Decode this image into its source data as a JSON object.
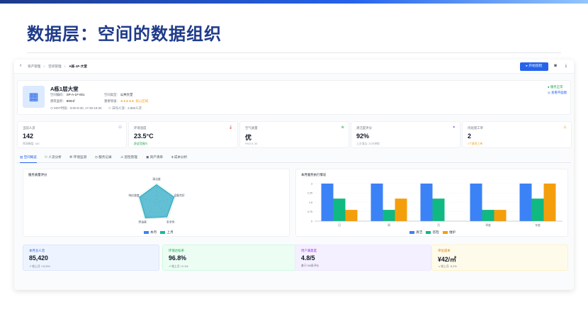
{
  "slide": {
    "title": "数据层：空间的数据组织"
  },
  "header": {
    "breadcrumb": [
      "资产管理",
      "空间管理",
      "A栋-1F-大堂"
    ],
    "start_button": "开始巡检"
  },
  "space": {
    "name": "A栋1层大堂",
    "code_label": "空间编码:",
    "code": "SP-A-1F-001",
    "type_label": "空间类型:",
    "type": "公共大堂",
    "area_label": "建筑面积:",
    "area": "800㎡",
    "importance_label": "重要等级:",
    "importance_stars": "★★★★★",
    "importance_text": "核心区域",
    "hours": "MOT时段：8:00-9:30, 17:30-19:30",
    "flow": "日均人流：2,850人次",
    "status": "● 服务正常",
    "status_link": "◎ 查看平面图"
  },
  "stats": [
    {
      "label": "当前人流",
      "value": "142",
      "sub": "预测峰值: 180",
      "icon": "people-icon",
      "color": "#3b82f6"
    },
    {
      "label": "环境温度",
      "value": "23.5°C",
      "sub": "舒适范围内",
      "icon": "thermometer-icon",
      "color": "#ef4444",
      "sub_color": "#16a34a"
    },
    {
      "label": "空气质量",
      "value": "优",
      "sub": "PM2.5: 35",
      "icon": "wind-icon",
      "color": "#16a34a"
    },
    {
      "label": "清洁度评分",
      "value": "92%",
      "sub": "上次清洁: 20分钟前",
      "icon": "sparkle-icon",
      "color": "#8b5cf6"
    },
    {
      "label": "待处理工单",
      "value": "2",
      "sub": "1个紧急工单",
      "icon": "warning-icon",
      "color": "#f59e0b",
      "sub_color": "#f59e0b"
    }
  ],
  "tabs": [
    "空间概览",
    "人流分析",
    "环境监测",
    "服务记录",
    "巡检管理",
    "资产清单",
    "成本分析"
  ],
  "radar": {
    "title": "服务质量评分",
    "axes": [
      "清洁度",
      "设备完好",
      "安全性",
      "舒适度",
      "响应速度"
    ],
    "series": [
      {
        "name": "本月",
        "values": [
          4.6,
          4.7,
          4.5,
          4.8,
          4.6
        ],
        "color": "#14b8a6"
      },
      {
        "name": "上月",
        "values": [
          4.5,
          4.5,
          4.4,
          4.6,
          4.4
        ],
        "color": "#3b82f6"
      }
    ],
    "max": 5
  },
  "chart_data": {
    "type": "bar",
    "title": "本月服务执行情况",
    "categories": [
      "日",
      "周",
      "月",
      "季度",
      "年度"
    ],
    "series": [
      {
        "name": "清洁",
        "values": [
          3,
          3,
          3,
          3,
          3
        ],
        "color": "#3b82f6"
      },
      {
        "name": "巡检",
        "values": [
          1.8,
          0.9,
          1.8,
          0.9,
          1.8
        ],
        "color": "#10b981"
      },
      {
        "name": "维护",
        "values": [
          0.9,
          1.8,
          0,
          0.9,
          3
        ],
        "color": "#f59e0b"
      }
    ],
    "yticks": [
      "0",
      "0.75",
      "1.5",
      "2.25",
      "3"
    ],
    "ylim": [
      0,
      3
    ],
    "legend": "bottom-center"
  },
  "kpis": [
    {
      "label": "本月总人流",
      "value": "85,420",
      "sub": "↗ 较上月 +12.5%",
      "bg": "#eef4ff",
      "border": "#dbe6ff",
      "color": "#2563eb"
    },
    {
      "label": "环境达标率",
      "value": "96.8%",
      "sub": "↗ 较上月 +2.1%",
      "bg": "#ecfdf3",
      "border": "#d1fae5",
      "color": "#16a34a"
    },
    {
      "label": "用户满意度",
      "value": "4.8/5",
      "sub": "基于156条评价",
      "bg": "#f5f0ff",
      "border": "#ede9fe",
      "color": "#9333ea"
    },
    {
      "label": "单位成本",
      "value": "¥42/㎡",
      "sub": "↘ 较上月 -5.2%",
      "bg": "#fffbeb",
      "border": "#fef3c7",
      "color": "#d97706"
    }
  ]
}
